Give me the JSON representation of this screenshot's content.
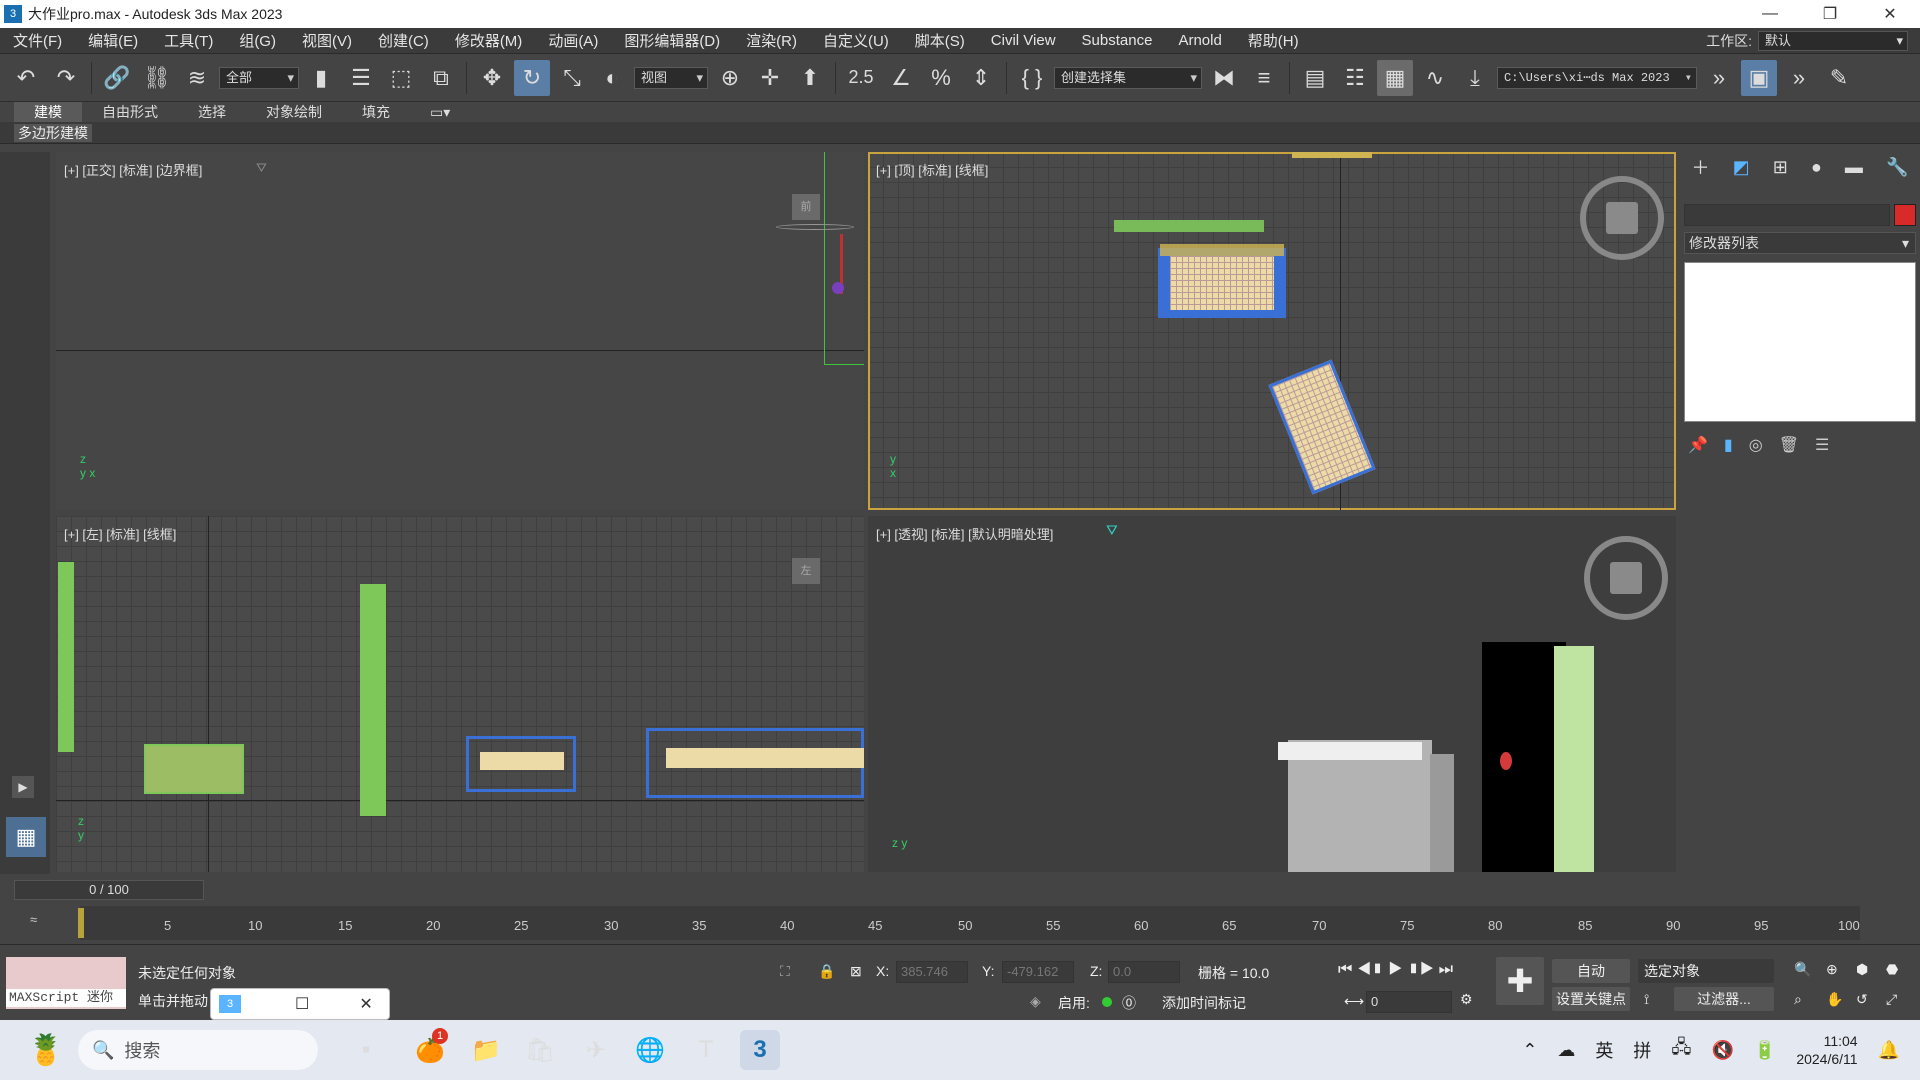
{
  "titlebar": {
    "title": "大作业pro.max - Autodesk 3ds Max 2023",
    "app_icon": "3",
    "minimize": "—",
    "restore": "❐",
    "close": "✕"
  },
  "menu": {
    "items": [
      "文件(F)",
      "编辑(E)",
      "工具(T)",
      "组(G)",
      "视图(V)",
      "创建(C)",
      "修改器(M)",
      "动画(A)",
      "图形编辑器(D)",
      "渲染(R)",
      "自定义(U)",
      "脚本(S)",
      "Civil View",
      "Substance",
      "Arnold",
      "帮助(H)"
    ],
    "workspace_label": "工作区:",
    "workspace_value": "默认"
  },
  "toolbar": {
    "filter_value": "全部",
    "refcoord_value": "视图",
    "selset_value": "创建选择集",
    "path_value": "C:\\Users\\xi⋯ds Max 2023",
    "snap_label": "2.5"
  },
  "ribbon": {
    "tabs": [
      "建模",
      "自由形式",
      "选择",
      "对象绘制",
      "填充"
    ],
    "active_tab": "建模",
    "sub_label": "多边形建模"
  },
  "viewports": {
    "front": {
      "label": "[+] [正交] [标准] [边界框]",
      "cube": "前"
    },
    "top": {
      "label": "[+] [顶] [标准] [线框]"
    },
    "left": {
      "label": "[+] [左] [标准] [线框]",
      "cube": "左"
    },
    "persp": {
      "label": "[+] [透视] [标准] [默认明暗处理]"
    }
  },
  "cmdpanel": {
    "modifier_list": "修改器列表",
    "accent": "#d92a2a"
  },
  "timeline": {
    "frame": "0 / 100",
    "ticks": [
      "5",
      "10",
      "15",
      "20",
      "25",
      "30",
      "35",
      "40",
      "45",
      "50",
      "55",
      "60",
      "65",
      "70",
      "75",
      "80",
      "85",
      "90",
      "95",
      "100"
    ]
  },
  "status": {
    "maxscript": "MAXScript 迷你",
    "msg1": "未选定任何对象",
    "msg2": "单击并拖动",
    "x_label": "X:",
    "x_value": "385.746",
    "y_label": "Y:",
    "y_value": "-479.162",
    "z_label": "Z:",
    "z_value": "0.0",
    "grid": "栅格 = 10.0",
    "enable": "启用:",
    "addtime": "添加时间标记",
    "auto": "自动",
    "setkey": "设置关键点",
    "selected": "选定对象",
    "filters": "过滤器...",
    "frame_field": "0"
  },
  "taskbar": {
    "search_placeholder": "搜索",
    "badge": "1",
    "ime1": "英",
    "ime2": "拼",
    "time": "11:04",
    "date": "2024/6/11"
  }
}
